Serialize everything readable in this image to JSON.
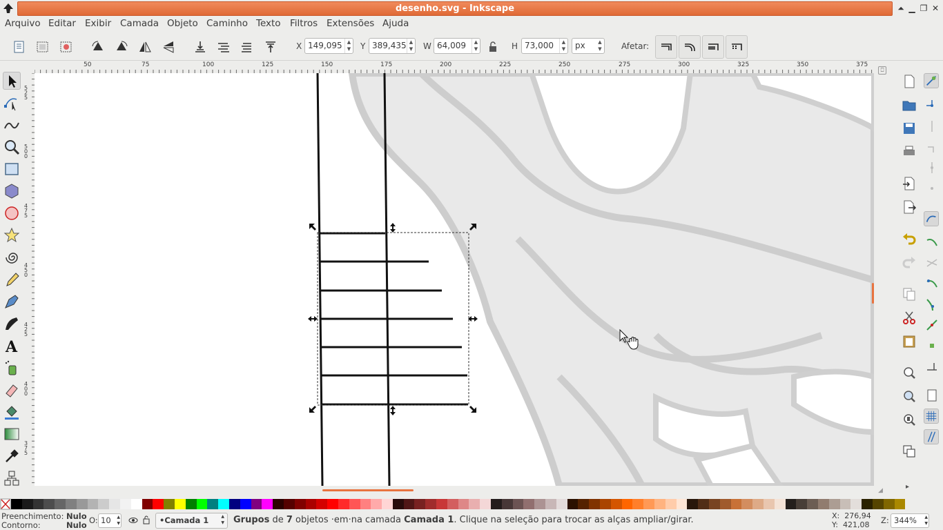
{
  "window": {
    "title": "desenho.svg - Inkscape"
  },
  "menu": [
    "Arquivo",
    "Editar",
    "Exibir",
    "Camada",
    "Objeto",
    "Caminho",
    "Texto",
    "Filtros",
    "Extensões",
    "Ajuda"
  ],
  "toolbar": {
    "x_label": "X",
    "x_value": "149,095",
    "y_label": "Y",
    "y_value": "389,435",
    "w_label": "W",
    "w_value": "64,009",
    "h_label": "H",
    "h_value": "73,000",
    "unit": "px",
    "affect_label": "Afetar:"
  },
  "ruler_top": {
    "labels": [
      "50",
      "75",
      "100",
      "125",
      "150",
      "175",
      "200",
      "225",
      "250",
      "275",
      "300",
      "325",
      "350",
      "375"
    ]
  },
  "ruler_left": {
    "labels": [
      "525",
      "500",
      "475",
      "450",
      "425",
      "400",
      "375"
    ]
  },
  "palette": {
    "colors": [
      "#000000",
      "#1a1a1a",
      "#333333",
      "#4d4d4d",
      "#666666",
      "#808080",
      "#999999",
      "#b3b3b3",
      "#cccccc",
      "#e6e6e6",
      "#f2f2f2",
      "#ffffff",
      "#800000",
      "#ff0000",
      "#808000",
      "#ffff00",
      "#008000",
      "#00ff00",
      "#008080",
      "#00ffff",
      "#000080",
      "#0000ff",
      "#800080",
      "#ff00ff",
      "#2b0000",
      "#550000",
      "#800000",
      "#aa0000",
      "#d40000",
      "#ff0000",
      "#ff2a2a",
      "#ff5555",
      "#ff8080",
      "#ffaaaa",
      "#ffd5d5",
      "#280b0b",
      "#501616",
      "#782121",
      "#a02c2c",
      "#c83737",
      "#d35f5f",
      "#de8787",
      "#e9afaf",
      "#f4d7d7",
      "#241c1c",
      "#483737",
      "#6c5353",
      "#916f6f",
      "#ac9393",
      "#c8b7b7",
      "#e3dbdb",
      "#2b1100",
      "#552200",
      "#803300",
      "#aa4400",
      "#d45500",
      "#ff6600",
      "#ff7f2a",
      "#ff9955",
      "#ffb380",
      "#ffccaa",
      "#ffe6d5",
      "#28170b",
      "#502d16",
      "#784421",
      "#a05a2c",
      "#c87137",
      "#d38d5f",
      "#deaa87",
      "#e9c6af",
      "#f4e3d7",
      "#241f1c",
      "#483e37",
      "#6c5d53",
      "#917c6f",
      "#ac9d93",
      "#c8beb7",
      "#e3dedb",
      "#2b2200",
      "#554400",
      "#806600",
      "#aa8800"
    ]
  },
  "statusbar": {
    "fill_label": "Preenchimento:",
    "fill_value": "Nulo",
    "stroke_label": "Contorno:",
    "stroke_value": "Nulo",
    "opacity_label": "O:",
    "opacity_value": "10",
    "layer": "•Camada 1",
    "message_prefix": "Grupos",
    "message_mid1": " de ",
    "message_count": "7",
    "message_mid2": " objetos ·em·na camada ",
    "message_layer": "Camada 1",
    "message_suffix": ". Clique na seleção para trocar as alças ampliar/girar.",
    "x_coord": "X:  276,94",
    "y_coord": "Y:  421,08",
    "zoom_label": "Z:",
    "zoom_value": "344%"
  },
  "colors": {
    "accent": "#e8733f",
    "canvas_bg": "#ffffff",
    "ui_bg": "#ededeb"
  }
}
